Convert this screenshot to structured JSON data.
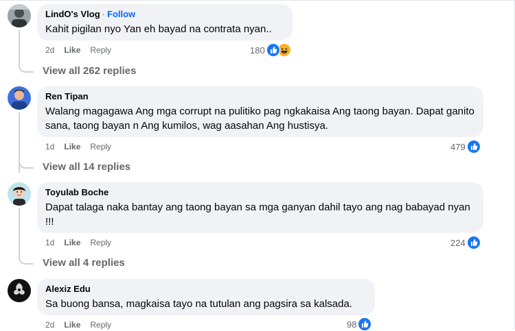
{
  "comments": [
    {
      "author": "LindO's Vlog",
      "follow": "Follow",
      "text": "Kahit pigilan nyo Yan eh bayad na contrata nyan..",
      "time": "2d",
      "like": "Like",
      "reply": "Reply",
      "reactions": "180",
      "reaction_types": [
        "like-icon",
        "haha-icon"
      ],
      "view_replies": "View all 262 replies"
    },
    {
      "author": "Ren Tipan",
      "text": "Walang magagawa Ang mga corrupt na pulitiko pag ngkakaisa Ang taong bayan. Dapat ganito sana, taong bayan n Ang kumilos, wag aasahan Ang hustisya.",
      "time": "1d",
      "like": "Like",
      "reply": "Reply",
      "reactions": "479",
      "reaction_types": [
        "like-icon"
      ],
      "view_replies": "View all 14 replies"
    },
    {
      "author": "Toyulab Boche",
      "text": "Dapat talaga naka bantay ang taong bayan sa mga ganyan dahil tayo ang nag babayad nyan !!!",
      "time": "1d",
      "like": "Like",
      "reply": "Reply",
      "reactions": "224",
      "reaction_types": [
        "like-icon"
      ],
      "view_replies": "View all 4 replies"
    },
    {
      "author": "Alexiz Edu",
      "text": "Sa buong bansa, magkaisa tayo na tutulan ang pagsira sa kalsada.",
      "time": "2d",
      "like": "Like",
      "reply": "Reply",
      "reactions": "98",
      "reaction_types": [
        "like-icon"
      ]
    }
  ],
  "colors": {
    "bubble": "#f0f2f5",
    "secondary_text": "#65676b",
    "follow": "#0866ff",
    "like_reaction": "#1877f2",
    "haha_reaction": "#f7b125"
  }
}
